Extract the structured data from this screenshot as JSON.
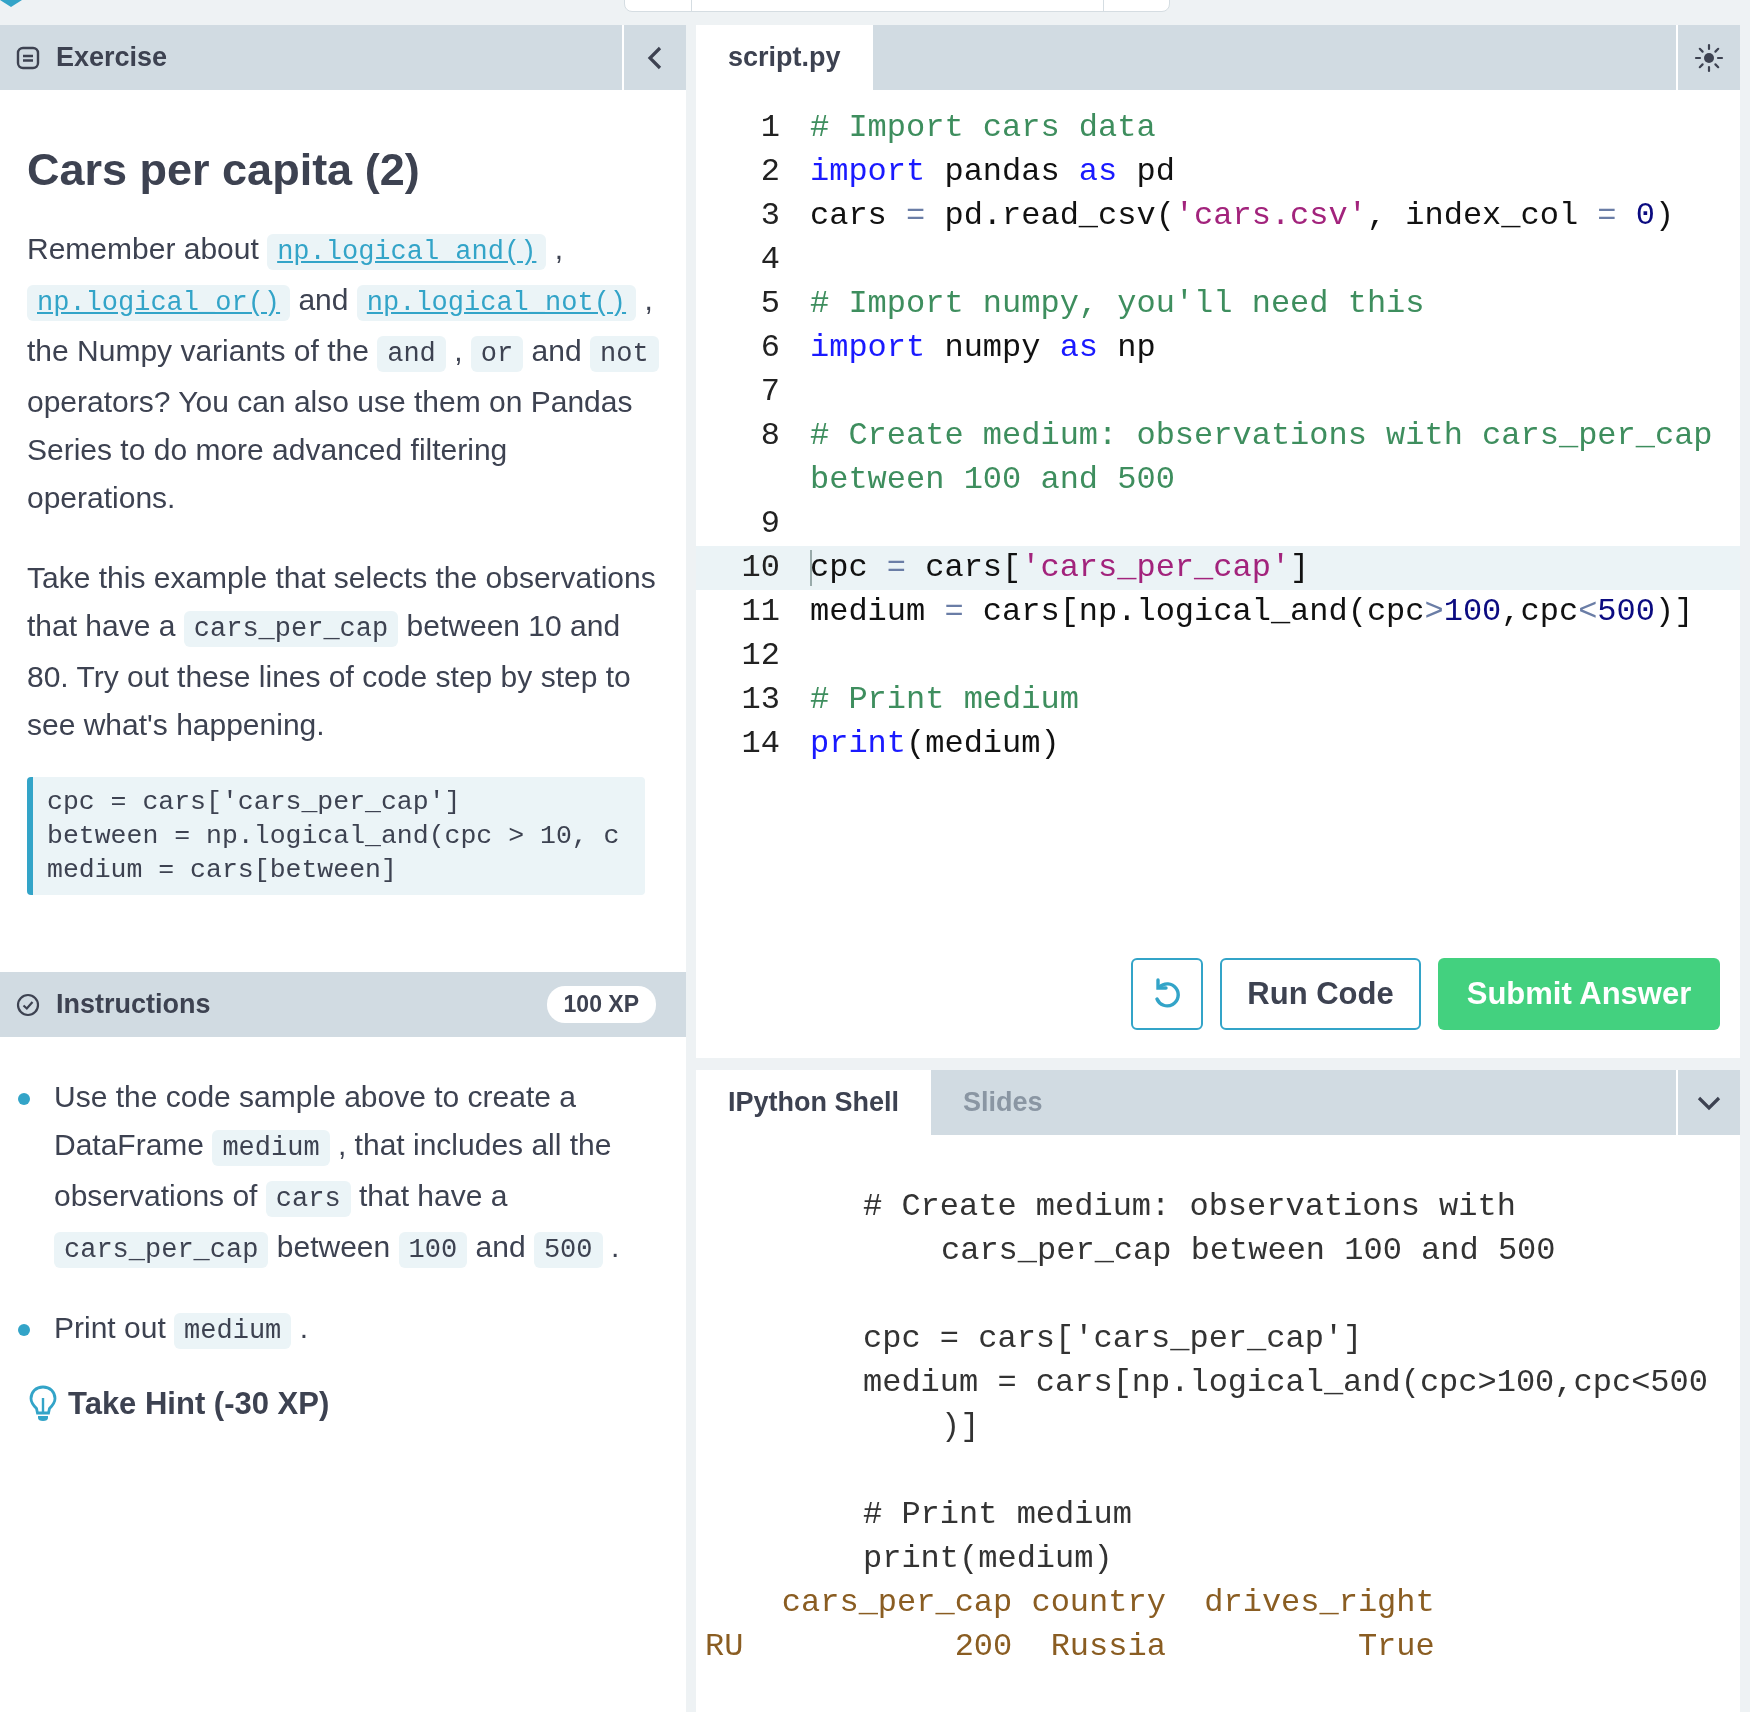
{
  "exercise_panel": {
    "title": "Exercise",
    "heading": "Cars per capita (2)",
    "paragraphs": [
      [
        {
          "kind": "text",
          "text": "Remember about"
        },
        {
          "kind": "link",
          "text": "np.logical_and()"
        },
        {
          "kind": "text",
          "text": ","
        },
        {
          "kind": "link",
          "text": "np.logical_or()"
        },
        {
          "kind": "text",
          "text": "and"
        },
        {
          "kind": "link",
          "text": "np.logical_not()"
        },
        {
          "kind": "text",
          "text": ", the Numpy variants of the"
        },
        {
          "kind": "code",
          "text": "and"
        },
        {
          "kind": "text",
          "text": ","
        },
        {
          "kind": "code",
          "text": "or"
        },
        {
          "kind": "text",
          "text": "and"
        },
        {
          "kind": "code",
          "text": "not"
        },
        {
          "kind": "text",
          "text": "operators? You can also use them on Pandas Series to do more advanced filtering operations."
        }
      ],
      [
        {
          "kind": "text",
          "text": "Take this example that selects the observations that have a"
        },
        {
          "kind": "code",
          "text": "cars_per_cap"
        },
        {
          "kind": "text",
          "text": "between 10 and 80. Try out these lines of code step by step to see what's happening."
        }
      ]
    ],
    "code_sample": [
      "cpc = cars['cars_per_cap']",
      "between = np.logical_and(cpc > 10, c",
      "medium = cars[between]"
    ]
  },
  "instructions": {
    "title": "Instructions",
    "xp": "100 XP",
    "items": [
      [
        {
          "kind": "text",
          "text": "Use the code sample above to create a DataFrame"
        },
        {
          "kind": "code",
          "text": "medium"
        },
        {
          "kind": "text",
          "text": ", that includes all the observations of"
        },
        {
          "kind": "code",
          "text": "cars"
        },
        {
          "kind": "text",
          "text": "that have a"
        },
        {
          "kind": "code",
          "text": "cars_per_cap"
        },
        {
          "kind": "text",
          "text": "between"
        },
        {
          "kind": "code",
          "text": "100"
        },
        {
          "kind": "text",
          "text": "and"
        },
        {
          "kind": "code",
          "text": "500"
        },
        {
          "kind": "text",
          "text": "."
        }
      ],
      [
        {
          "kind": "text",
          "text": "Print out"
        },
        {
          "kind": "code",
          "text": "medium"
        },
        {
          "kind": "text",
          "text": "."
        }
      ]
    ],
    "hint": "Take Hint (-30 XP)"
  },
  "editor": {
    "tabs": [
      {
        "label": "script.py",
        "selected": true
      }
    ],
    "lines": [
      {
        "number": "1",
        "active": false,
        "tokens": [
          {
            "kind": "comment",
            "text": "# Import cars data"
          }
        ]
      },
      {
        "number": "2",
        "active": false,
        "tokens": [
          {
            "kind": "keyword",
            "text": "import"
          },
          {
            "kind": "plain",
            "text": " pandas "
          },
          {
            "kind": "keyword",
            "text": "as"
          },
          {
            "kind": "plain",
            "text": " pd"
          }
        ]
      },
      {
        "number": "3",
        "active": false,
        "tokens": [
          {
            "kind": "plain",
            "text": "cars "
          },
          {
            "kind": "op",
            "text": "="
          },
          {
            "kind": "plain",
            "text": " pd.read_csv("
          },
          {
            "kind": "string",
            "text": "'cars.csv'"
          },
          {
            "kind": "plain",
            "text": ", index_col "
          },
          {
            "kind": "op",
            "text": "="
          },
          {
            "kind": "number",
            "text": " 0"
          },
          {
            "kind": "plain",
            "text": ")"
          }
        ]
      },
      {
        "number": "4",
        "active": false
      },
      {
        "number": "5",
        "active": false,
        "tokens": [
          {
            "kind": "comment",
            "text": "# Import numpy, you'll need this"
          }
        ]
      },
      {
        "number": "6",
        "active": false,
        "tokens": [
          {
            "kind": "keyword",
            "text": "import"
          },
          {
            "kind": "plain",
            "text": " numpy "
          },
          {
            "kind": "keyword",
            "text": "as"
          },
          {
            "kind": "plain",
            "text": " np"
          }
        ]
      },
      {
        "number": "7",
        "active": false
      },
      {
        "number": "8",
        "active": false,
        "tokens": [
          {
            "kind": "comment",
            "text": "# Create medium: observations with cars_per_cap between 100 and 500"
          }
        ]
      },
      {
        "number": "9",
        "active": false
      },
      {
        "number": "10",
        "active": true,
        "tokens": [
          {
            "kind": "plain",
            "text": "cpc "
          },
          {
            "kind": "op",
            "text": "="
          },
          {
            "kind": "plain",
            "text": " cars["
          },
          {
            "kind": "string",
            "text": "'cars_per_cap'"
          },
          {
            "kind": "plain",
            "text": "]"
          }
        ]
      },
      {
        "number": "11",
        "active": false,
        "tokens": [
          {
            "kind": "plain",
            "text": "medium "
          },
          {
            "kind": "op",
            "text": "="
          },
          {
            "kind": "plain",
            "text": " cars[np.logical_and(cpc"
          },
          {
            "kind": "op",
            "text": ">"
          },
          {
            "kind": "number",
            "text": "100"
          },
          {
            "kind": "plain",
            "text": ",cpc"
          },
          {
            "kind": "op",
            "text": "<"
          },
          {
            "kind": "number",
            "text": "500"
          },
          {
            "kind": "plain",
            "text": ")]"
          }
        ]
      },
      {
        "number": "12",
        "active": false
      },
      {
        "number": "13",
        "active": false,
        "tokens": [
          {
            "kind": "comment",
            "text": "# Print medium"
          }
        ]
      },
      {
        "number": "14",
        "active": false,
        "tokens": [
          {
            "kind": "keyword",
            "text": "print"
          },
          {
            "kind": "plain",
            "text": "(medium)"
          }
        ]
      }
    ],
    "buttons": [
      {
        "kind": "reset"
      },
      {
        "kind": "run",
        "label": "Run Code"
      },
      {
        "kind": "submit",
        "label": "Submit Answer"
      }
    ]
  },
  "shell": {
    "tabs": [
      {
        "label": "IPython Shell",
        "selected": true
      },
      {
        "label": "Slides",
        "selected": false
      }
    ],
    "entries": [
      {
        "kind": "input",
        "lines": [
          {
            "text": "# Create medium: observations with",
            "continuation": "cars_per_cap between 100 and 500"
          }
        ]
      },
      {
        "kind": "input",
        "lines": [
          {
            "text": "cpc = cars['cars_per_cap']"
          },
          {
            "text": "medium = cars[np.logical_and(cpc>100,cpc<500",
            "continuation": ")]"
          }
        ]
      },
      {
        "kind": "input",
        "lines": [
          {
            "text": "# Print medium"
          },
          {
            "text": "print(medium)"
          }
        ]
      },
      {
        "kind": "output",
        "lines": [
          {
            "text": "    cars_per_cap country  drives_right"
          },
          {
            "text": "RU           200  Russia          True"
          }
        ]
      }
    ]
  }
}
